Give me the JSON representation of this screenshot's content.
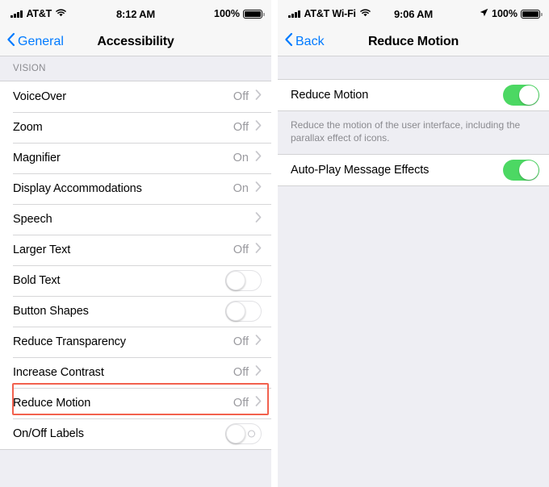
{
  "left": {
    "status_bar": {
      "signal_icon": "signal-bars-icon",
      "carrier": "AT&T",
      "wifi_icon": "wifi-icon",
      "time": "8:12 AM",
      "battery_percent": "100%",
      "battery_icon": "battery-full-icon"
    },
    "nav": {
      "back_label": "General",
      "back_icon": "chevron-left-icon",
      "title": "Accessibility"
    },
    "section_header": "VISION",
    "rows": [
      {
        "label": "VoiceOver",
        "value": "Off",
        "accessory": "chevron"
      },
      {
        "label": "Zoom",
        "value": "Off",
        "accessory": "chevron"
      },
      {
        "label": "Magnifier",
        "value": "On",
        "accessory": "chevron"
      },
      {
        "label": "Display Accommodations",
        "value": "On",
        "accessory": "chevron"
      },
      {
        "label": "Speech",
        "value": "",
        "accessory": "chevron"
      },
      {
        "label": "Larger Text",
        "value": "Off",
        "accessory": "chevron"
      },
      {
        "label": "Bold Text",
        "value": "",
        "accessory": "toggle-off"
      },
      {
        "label": "Button Shapes",
        "value": "",
        "accessory": "toggle-off"
      },
      {
        "label": "Reduce Transparency",
        "value": "Off",
        "accessory": "chevron"
      },
      {
        "label": "Increase Contrast",
        "value": "Off",
        "accessory": "chevron"
      },
      {
        "label": "Reduce Motion",
        "value": "Off",
        "accessory": "chevron",
        "highlighted": true
      },
      {
        "label": "On/Off Labels",
        "value": "",
        "accessory": "toggle-off-labeled"
      }
    ]
  },
  "right": {
    "status_bar": {
      "signal_icon": "signal-bars-icon",
      "carrier": "AT&T Wi-Fi",
      "wifi_icon": "wifi-icon",
      "time": "9:06 AM",
      "location_icon": "location-arrow-icon",
      "battery_percent": "100%",
      "battery_icon": "battery-full-icon"
    },
    "nav": {
      "back_label": "Back",
      "back_icon": "chevron-left-icon",
      "title": "Reduce Motion"
    },
    "rows": [
      {
        "label": "Reduce Motion",
        "accessory": "toggle-on"
      },
      {
        "label": "Auto-Play Message Effects",
        "accessory": "toggle-on"
      }
    ],
    "footnote": "Reduce the motion of the user interface, including the parallax effect of icons."
  },
  "colors": {
    "accent_blue": "#007AFF",
    "toggle_on_green": "#4CD863",
    "highlight_red": "#F2614E",
    "group_background": "#EEEEF3",
    "secondary_text": "#8A8A8F"
  }
}
